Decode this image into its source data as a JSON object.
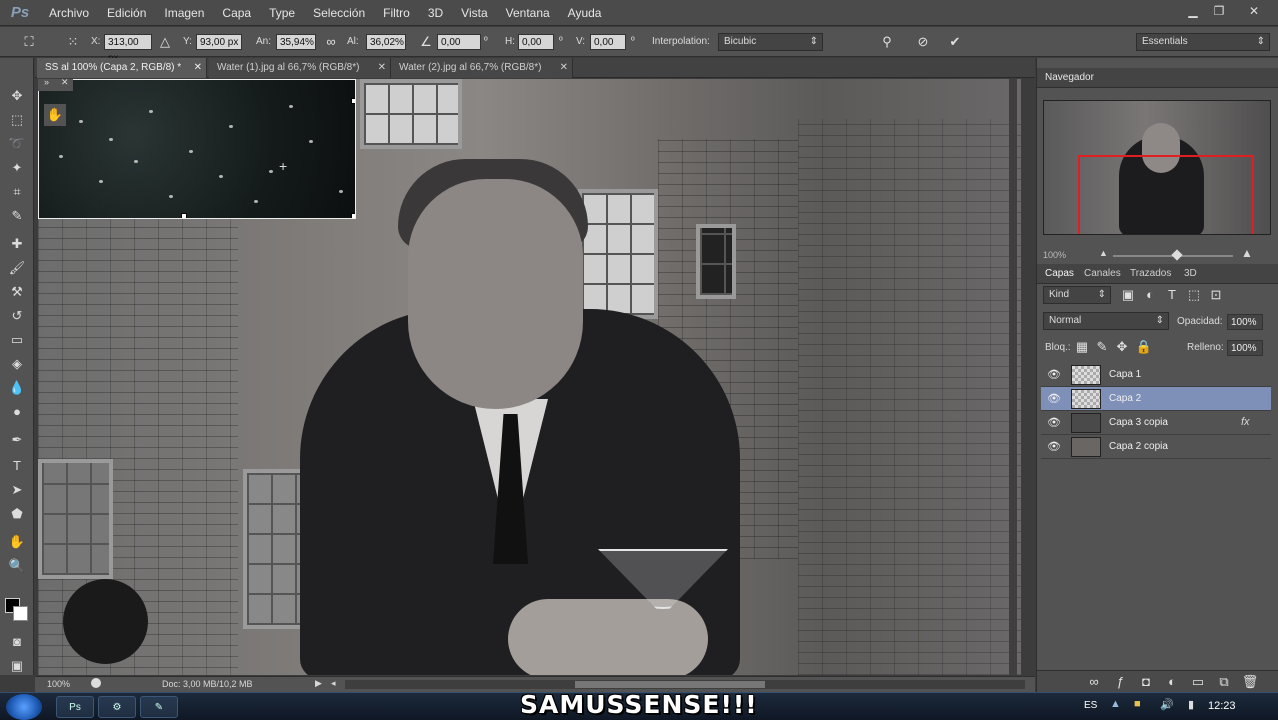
{
  "app": {
    "logo_text": "Ps"
  },
  "menu": [
    "Archivo",
    "Edición",
    "Imagen",
    "Capa",
    "Type",
    "Selección",
    "Filtro",
    "3D",
    "Vista",
    "Ventana",
    "Ayuda"
  ],
  "options_bar": {
    "x_label": "X:",
    "x_value": "313,00 px",
    "y_label": "Y:",
    "y_value": "93,00 px",
    "w_label": "An:",
    "w_value": "35,94%",
    "h_label": "Al:",
    "h_value": "36,02%",
    "angle_value": "0,00",
    "angle_unit": "º",
    "hskew_label": "H:",
    "hskew_value": "0,00",
    "hskew_unit": "º",
    "vskew_label": "V:",
    "vskew_value": "0,00",
    "vskew_unit": "º",
    "interp_label": "Interpolation:",
    "interp_value": "Bicubic",
    "workspace": "Essentials"
  },
  "tabs": [
    {
      "label": "SS al 100% (Capa 2, RGB/8) *",
      "active": true
    },
    {
      "label": "Water (1).jpg al 66,7% (RGB/8*)",
      "active": false
    },
    {
      "label": "Water (2).jpg al 66,7% (RGB/8*)",
      "active": false
    }
  ],
  "status": {
    "zoom": "100%",
    "doc": "Doc: 3,00 MB/10,2 MB"
  },
  "navigator": {
    "title": "Navegador",
    "zoom": "100%"
  },
  "layers_panel": {
    "tabs": [
      "Capas",
      "Canales",
      "Trazados",
      "3D"
    ],
    "kind_label": "Kind",
    "blend_mode": "Normal",
    "opacity_label": "Opacidad:",
    "opacity_value": "100%",
    "lock_label": "Bloq.:",
    "fill_label": "Relleno:",
    "fill_value": "100%",
    "layers": [
      {
        "name": "Capa 1",
        "selected": false
      },
      {
        "name": "Capa 2",
        "selected": true
      },
      {
        "name": "Capa 3 copia",
        "selected": false,
        "fx": "fx"
      },
      {
        "name": "Capa 2 copia",
        "selected": false
      }
    ]
  },
  "taskbar": {
    "lang": "ES",
    "time": "12:23"
  },
  "watermark": "SAMUSSENSE!!!"
}
